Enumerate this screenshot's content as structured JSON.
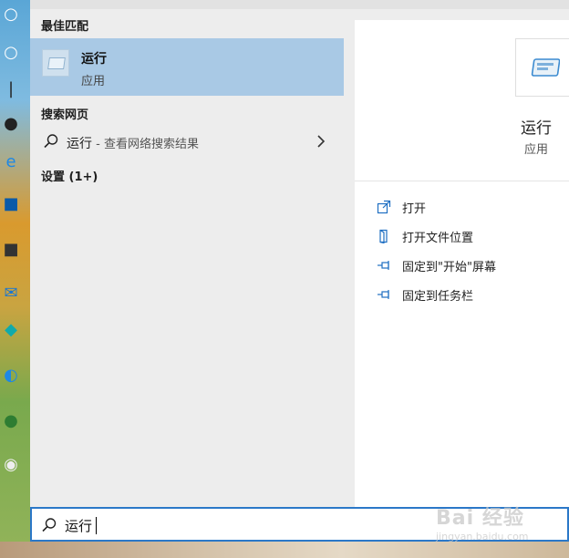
{
  "left_panel": {
    "best_match_title": "最佳匹配",
    "best_match": {
      "name": "运行",
      "type": "应用"
    },
    "web_title": "搜索网页",
    "web_result": {
      "query": "运行",
      "hint": " - 查看网络搜索结果"
    },
    "settings_title": "设置 (1+)"
  },
  "preview": {
    "app_name": "运行",
    "app_type": "应用",
    "actions": [
      {
        "label": "打开",
        "icon": "open-icon"
      },
      {
        "label": "打开文件位置",
        "icon": "file-location-icon"
      },
      {
        "label": "固定到\"开始\"屏幕",
        "icon": "pin-icon"
      },
      {
        "label": "固定到任务栏",
        "icon": "pin-icon"
      }
    ]
  },
  "search": {
    "value": "运行"
  },
  "watermark": {
    "text": "Bai 经验",
    "sub": "jingyan.baidu.com"
  },
  "colors": {
    "accent": "#2b78c8",
    "selected": "#a9c9e5"
  }
}
